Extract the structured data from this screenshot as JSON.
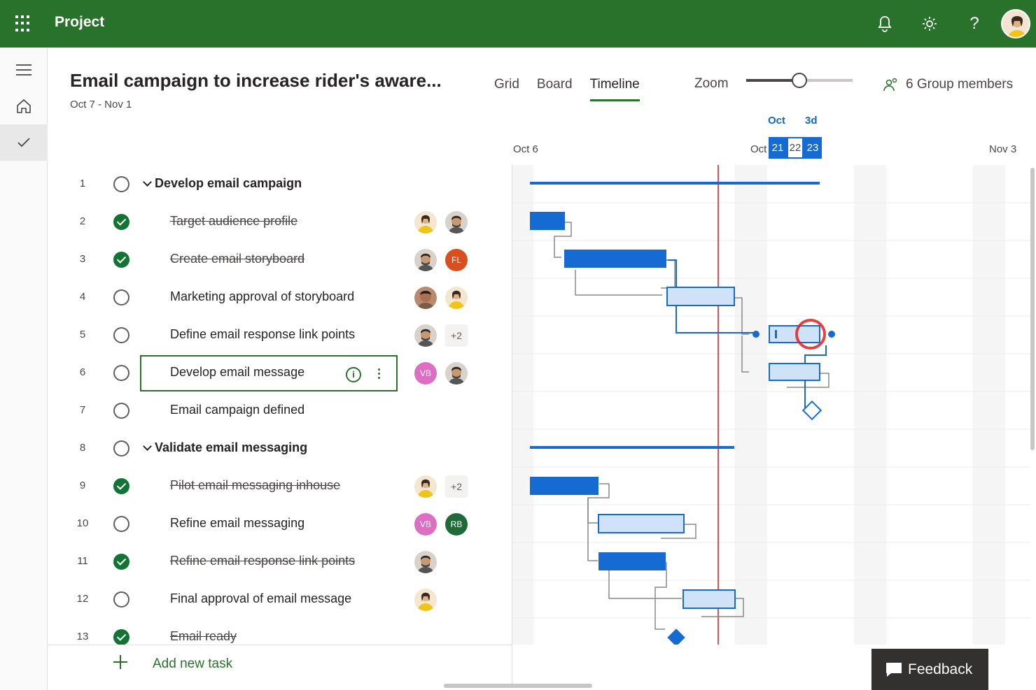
{
  "app": {
    "title": "Project"
  },
  "header": {
    "plan_title": "Email campaign to increase rider's aware...",
    "plan_dates": "Oct 7 - Nov 1",
    "views": [
      "Grid",
      "Board",
      "Timeline"
    ],
    "active_view": "Timeline",
    "zoom_label": "Zoom",
    "zoom_level": 0.5,
    "members_label": "6 Group members"
  },
  "timeline_header": {
    "month_label": "Oct",
    "duration_label": "3d",
    "start_label": "Oct 6",
    "mid_label": "Oct",
    "days": [
      "21",
      "22",
      "23"
    ],
    "end_label": "Nov 3"
  },
  "tasks": [
    {
      "num": "1",
      "name": "Develop email campaign",
      "group": true,
      "done": false,
      "assignees": []
    },
    {
      "num": "2",
      "name": "Target audience profile",
      "done": true,
      "assignees": [
        "photo-f",
        "photo-m"
      ]
    },
    {
      "num": "3",
      "name": "Create email storyboard",
      "done": true,
      "assignees": [
        "photo-m",
        "FL"
      ]
    },
    {
      "num": "4",
      "name": "Marketing approval of storyboard",
      "done": false,
      "assignees": [
        "photo-m2",
        "photo-f"
      ]
    },
    {
      "num": "5",
      "name": "Define email response link points",
      "done": false,
      "assignees": [
        "photo-m",
        "+2"
      ]
    },
    {
      "num": "6",
      "name": "Develop email message",
      "done": false,
      "selected": true,
      "assignees": [
        "VB",
        "photo-m"
      ]
    },
    {
      "num": "7",
      "name": "Email campaign defined",
      "done": false,
      "assignees": []
    },
    {
      "num": "8",
      "name": "Validate email messaging",
      "group": true,
      "done": false,
      "assignees": []
    },
    {
      "num": "9",
      "name": "Pilot email messaging inhouse",
      "done": true,
      "assignees": [
        "photo-f",
        "+2"
      ]
    },
    {
      "num": "10",
      "name": "Refine email messaging",
      "done": false,
      "assignees": [
        "VB",
        "RB"
      ]
    },
    {
      "num": "11",
      "name": "Refine email response link points",
      "done": true,
      "assignees": [
        "photo-m"
      ]
    },
    {
      "num": "12",
      "name": "Final approval of email message",
      "done": false,
      "assignees": [
        "photo-f"
      ]
    },
    {
      "num": "13",
      "name": "Email ready",
      "done": true,
      "assignees": []
    }
  ],
  "footer": {
    "add_task_label": "Add new task",
    "feedback_label": "Feedback"
  },
  "colors": {
    "brand": "#28722b",
    "bar": "#166bd3",
    "bar_light": "#cfe2f7",
    "today": "#e05050"
  },
  "icons": [
    "waffle-icon",
    "bell-icon",
    "gear-icon",
    "help-icon",
    "hamburger-icon",
    "home-icon",
    "check-icon",
    "people-icon",
    "info-icon",
    "more-icon",
    "plus-icon",
    "feedback-icon"
  ]
}
